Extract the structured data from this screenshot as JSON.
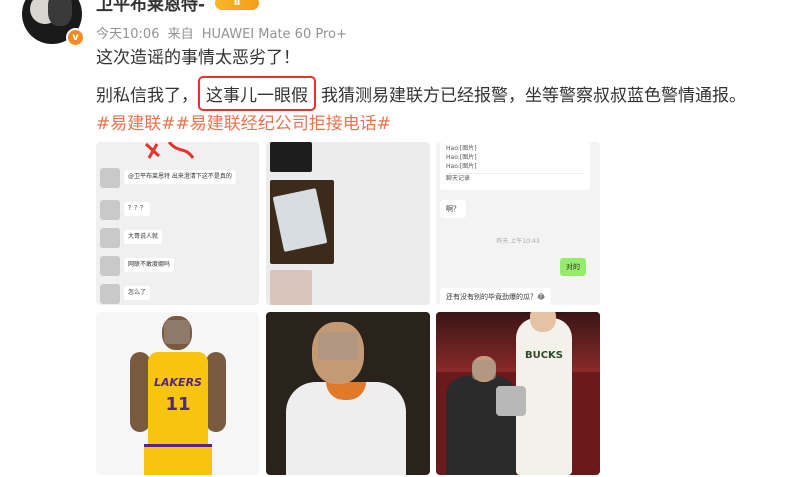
{
  "post": {
    "username": "卫平布莱恩特",
    "username_suffix": "-",
    "badge_text": "Ⅱ",
    "time": "今天10:06",
    "source_prefix": "来自",
    "source_device": "HUAWEI Mate 60 Pro+",
    "line1": "这次造谣的事情太恶劣了！",
    "line2_pre": "别私信我了，",
    "line2_boxed": "这事儿一眼假",
    "line2_post": "我猜测易建联方已经报警，坐等警察叔叔蓝色警情通报。",
    "hashtags": [
      "#易建联#",
      "#易建联经纪公司拒接电话#"
    ]
  },
  "images": {
    "chat1": {
      "messages": [
        "@卫平布莱恩特 出来澄清下这不是真的",
        "？？？",
        "大哥说人就",
        "网联不敢度娜吗",
        "怎么了"
      ]
    },
    "chat3": {
      "top_lines": [
        "Hao:[图片]",
        "Hao:[图片]",
        "Hao:[图片]",
        "聊天记录"
      ],
      "msg1": "啊？",
      "time": "昨天 上午10:43",
      "reply": "对的",
      "msg2": "还有没有别的毕竟劲爆的瓜？😂"
    },
    "photo4": {
      "team": "LAKERS",
      "number": "11"
    },
    "photo6": {
      "team": "BUCKS"
    }
  },
  "colors": {
    "hashtag": "#eb7350",
    "highlight_box": "#e8322b",
    "meta": "#939393"
  }
}
